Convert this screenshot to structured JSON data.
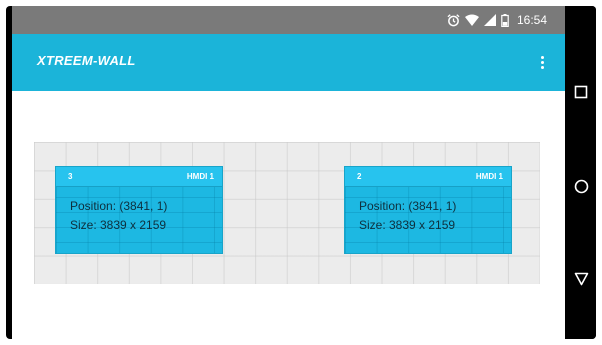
{
  "status_bar": {
    "time": "16:54",
    "icons": [
      "alarm-icon",
      "wifi-icon",
      "signal-icon",
      "battery-icon"
    ]
  },
  "app": {
    "title": "XTREEM-WALL",
    "overflow_icon": "overflow-menu-icon"
  },
  "displays": [
    {
      "id": "3",
      "input": "HMDI 1",
      "position": "Position: (3841, 1)",
      "size": "Size: 3839 x 2159"
    },
    {
      "id": "2",
      "input": "HMDI 1",
      "position": "Position: (3841, 1)",
      "size": "Size: 3839 x 2159"
    }
  ],
  "nav": [
    "recents-icon",
    "home-icon",
    "back-icon"
  ],
  "colors": {
    "app_bar": "#1bb4d9",
    "tile": "#1db8e2",
    "status_bar": "#7a7a7a"
  }
}
